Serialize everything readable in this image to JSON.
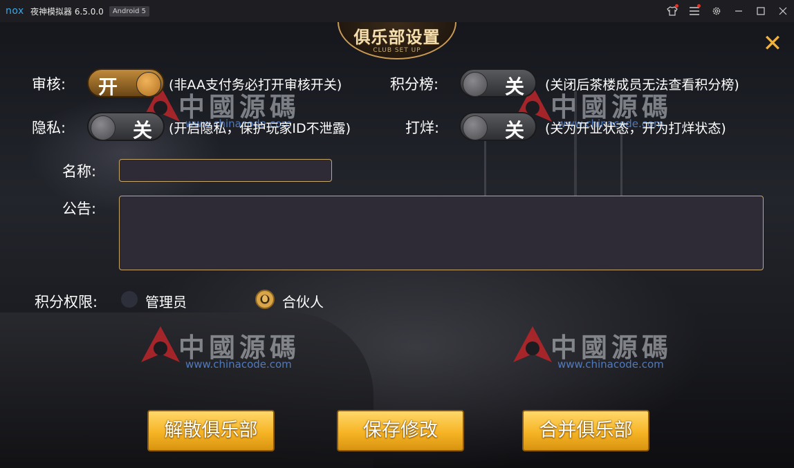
{
  "titlebar": {
    "logo": "nox",
    "title": "夜神模拟器 6.5.0.0",
    "android": "Android 5",
    "icons": [
      "shirt-icon",
      "menu-icon",
      "gear-icon",
      "minimize-icon",
      "maximize-icon",
      "close-icon"
    ]
  },
  "header": {
    "title": "俱乐部设置",
    "subtitle": "CLUB SET UP"
  },
  "close_glyph": "✕",
  "settings": {
    "audit": {
      "label": "审核:",
      "state": "开",
      "desc": "(非AA支付务必打开审核开关)"
    },
    "leaderboard": {
      "label": "积分榜:",
      "state": "关",
      "desc": "(关闭后茶楼成员无法查看积分榜)"
    },
    "privacy": {
      "label": "隐私:",
      "state": "关",
      "desc": "(开启隐私，保护玩家ID不泄露)"
    },
    "closing": {
      "label": "打烊:",
      "state": "关",
      "desc": "(关为开业状态，开为打烊状态)"
    }
  },
  "form": {
    "name_label": "名称:",
    "name_value": "",
    "notice_label": "公告:",
    "notice_value": ""
  },
  "permission": {
    "label": "积分权限:",
    "options": [
      {
        "label": "管理员",
        "checked": false
      },
      {
        "label": "合伙人",
        "checked": true
      }
    ]
  },
  "buttons": {
    "dissolve": "解散俱乐部",
    "save": "保存修改",
    "merge": "合并俱乐部"
  },
  "watermark": {
    "text": "中國源碼",
    "url": "www.chinacode.com"
  },
  "colors": {
    "accent": "#f6b425",
    "border": "#c8a76a",
    "close": "#f2b23c",
    "nox": "#3aa8e8"
  }
}
